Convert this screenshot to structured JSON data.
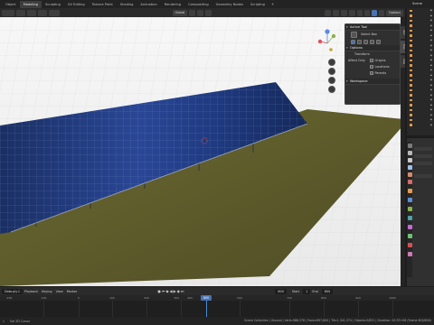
{
  "topbar": {
    "workspaces": [
      "Modeling",
      "Sculpting",
      "UV Editing",
      "Texture Paint",
      "Shading",
      "Animation",
      "Rendering",
      "Compositing",
      "Geometry Nodes",
      "Scripting"
    ],
    "active_index": 0,
    "left_label": "Object",
    "plus": "+"
  },
  "header": {
    "orientation": "Global",
    "options": "Options"
  },
  "npanel": {
    "active_tool": "Active Tool",
    "tool_name": "Select Box",
    "options": "Options",
    "transform": "Transform",
    "affect_only": "Affect Only",
    "origins": "Origins",
    "locations": "Locations",
    "parents": "Parents",
    "workspace": "Workspace"
  },
  "sidebar_tabs": [
    "Item",
    "Tool",
    "View"
  ],
  "outliner": {
    "title": "Scene",
    "rows": [
      "",
      "",
      "",
      "",
      "",
      "",
      "",
      "",
      "",
      "",
      "",
      "",
      "",
      "",
      "",
      "",
      "",
      "",
      "",
      "",
      ""
    ]
  },
  "timeline": {
    "file_tab": "Data.ply.1",
    "playback": "Playback",
    "keying": "Keying",
    "view": "View",
    "marker": "Marker",
    "current_frame": "600",
    "start_label": "Start",
    "start_value": "1",
    "end_label": "End",
    "end_value": "800",
    "playhead_label": "600",
    "ticks": [
      "-200",
      "-100",
      "0",
      "100",
      "200",
      "300",
      "400",
      "500",
      "600",
      "700",
      "800",
      "900",
      "1000"
    ]
  },
  "status": {
    "left": "Set 3D Cursor",
    "right": "Scene Collection | Ground | Verts:988,378 | Faces:697,800 | Tris:1,341,374 | Objects:0/831 | Duration: 00:33+08 (Frame 600/800)"
  },
  "colors": {
    "accent": "#4772b3",
    "grass": "#5e5c2c",
    "panel_blue": "#213a78"
  }
}
